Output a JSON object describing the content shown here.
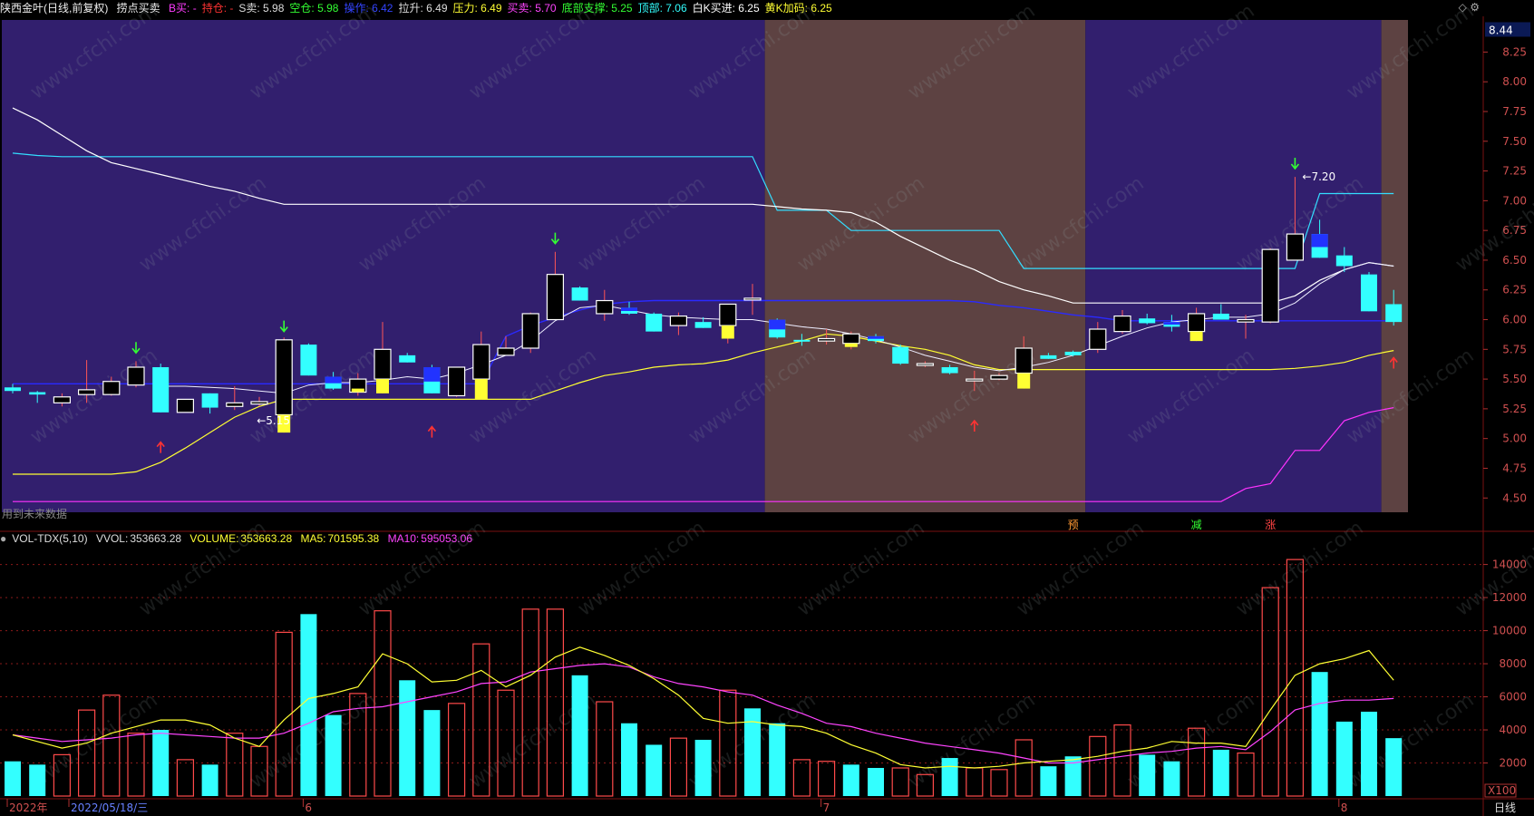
{
  "header": {
    "stock_title": "陕西金叶(日线,前复权)",
    "indicator_name": "捞点买卖",
    "items": [
      {
        "label": "B买:",
        "value": "-",
        "color": "#ff3cff"
      },
      {
        "label": "持仓:",
        "value": "-",
        "color": "#ff3333"
      },
      {
        "label": "S卖:",
        "value": "5.98",
        "color": "#dddddd"
      },
      {
        "label": "空仓:",
        "value": "5.98",
        "color": "#33ff33"
      },
      {
        "label": "操作:",
        "value": "6.42",
        "color": "#3344ff"
      },
      {
        "label": "拉升:",
        "value": "6.49",
        "color": "#dddddd"
      },
      {
        "label": "压力:",
        "value": "6.49",
        "color": "#ffff33"
      },
      {
        "label": "买卖:",
        "value": "5.70",
        "color": "#ff44ff"
      },
      {
        "label": "底部支撑:",
        "value": "5.25",
        "color": "#33ff33"
      },
      {
        "label": "顶部:",
        "value": "7.06",
        "color": "#33ffff"
      },
      {
        "label": "白K买进:",
        "value": "6.25",
        "color": "#ffffff"
      },
      {
        "label": "黄K加码:",
        "value": "6.25",
        "color": "#ffff33"
      }
    ],
    "icons": [
      "diamond-icon",
      "gear-icon"
    ]
  },
  "volume_header": {
    "indicator": "VOL-TDX(5,10)",
    "vvol_label": "VVOL:",
    "vvol_value": "353663.28",
    "volume_label": "VOLUME:",
    "volume_value": "353663.28",
    "ma5_label": "MA5:",
    "ma5_value": "701595.38",
    "ma10_label": "MA10:",
    "ma10_value": "595053.06"
  },
  "price_axis": {
    "ticks": [
      "8.25",
      "8.00",
      "7.75",
      "7.50",
      "7.25",
      "7.00",
      "6.75",
      "6.50",
      "6.25",
      "6.00",
      "5.75",
      "5.50",
      "5.25",
      "5.00",
      "4.75",
      "4.50"
    ],
    "current_price": "8.44",
    "ylim": [
      4.38,
      8.52
    ]
  },
  "volume_axis": {
    "ticks": [
      "14000",
      "12000",
      "10000",
      "8000",
      "6000",
      "4000",
      "2000"
    ],
    "unit": "X100",
    "ylim": [
      0,
      14800
    ]
  },
  "time_axis": {
    "labels": [
      {
        "text": "2022年",
        "index": 0
      },
      {
        "text": "2022/05/18/三",
        "index": 2.5
      },
      {
        "text": "6",
        "index": 12
      },
      {
        "text": "7",
        "index": 33
      },
      {
        "text": "8",
        "index": 54
      }
    ],
    "period": "日线"
  },
  "annotations": {
    "left_note": "用到未来数据",
    "low_label": "←5.15",
    "high_label": "←7.20",
    "tags": [
      {
        "text": "预",
        "index": 43,
        "color": "#ff9933"
      },
      {
        "text": "减",
        "index": 48,
        "color": "#33ff33"
      },
      {
        "text": "涨",
        "index": 51,
        "color": "#ff4444"
      }
    ]
  },
  "colors": {
    "background_purple": "#321f6e",
    "background_brown": "#5d4242",
    "up_candle": "#ffffff",
    "down_candle": "#33ffff",
    "blue_candle": "#2233ff",
    "yellow_candle": "#ffff33",
    "volume_up": "#ff4a4a",
    "volume_down": "#33ffff",
    "ma5": "#ffff33",
    "ma10": "#ff44ff",
    "grid": "#8a1a1a"
  },
  "chart_data": {
    "type": "candlestick",
    "bg_zones": [
      {
        "from": 0,
        "to": 30,
        "color": "purple"
      },
      {
        "from": 31,
        "to": 43,
        "color": "brown"
      },
      {
        "from": 44,
        "to": 55,
        "color": "purple"
      },
      {
        "from": 56,
        "to": 57,
        "color": "brown"
      }
    ],
    "candles": [
      {
        "o": 5.43,
        "h": 5.46,
        "l": 5.38,
        "c": 5.4,
        "t": "down"
      },
      {
        "o": 5.39,
        "h": 5.4,
        "l": 5.3,
        "c": 5.37,
        "t": "down"
      },
      {
        "o": 5.3,
        "h": 5.38,
        "l": 5.27,
        "c": 5.35,
        "t": "up"
      },
      {
        "o": 5.37,
        "h": 5.66,
        "l": 5.3,
        "c": 5.41,
        "t": "up"
      },
      {
        "o": 5.37,
        "h": 5.52,
        "l": 5.36,
        "c": 5.48,
        "t": "up"
      },
      {
        "o": 5.45,
        "h": 5.65,
        "l": 5.43,
        "c": 5.6,
        "t": "up"
      },
      {
        "o": 5.6,
        "h": 5.63,
        "l": 5.22,
        "c": 5.22,
        "t": "down"
      },
      {
        "o": 5.22,
        "h": 5.33,
        "l": 5.22,
        "c": 5.33,
        "t": "up"
      },
      {
        "o": 5.38,
        "h": 5.38,
        "l": 5.21,
        "c": 5.26,
        "t": "down"
      },
      {
        "o": 5.27,
        "h": 5.44,
        "l": 5.24,
        "c": 5.3,
        "t": "up"
      },
      {
        "o": 5.29,
        "h": 5.35,
        "l": 5.27,
        "c": 5.31,
        "t": "up"
      },
      {
        "o": 5.2,
        "h": 5.85,
        "l": 5.05,
        "c": 5.83,
        "t": "up",
        "ext": "yellow",
        "ext_low": 5.05,
        "ext_high": 5.2
      },
      {
        "o": 5.79,
        "h": 5.8,
        "l": 5.53,
        "c": 5.53,
        "t": "down"
      },
      {
        "o": 5.52,
        "h": 5.56,
        "l": 5.41,
        "c": 5.42,
        "t": "down",
        "mix": "blue"
      },
      {
        "o": 5.39,
        "h": 5.55,
        "l": 5.36,
        "c": 5.5,
        "t": "up",
        "ext": "yellow",
        "ext_low": 5.39,
        "ext_high": 5.42
      },
      {
        "o": 5.5,
        "h": 5.98,
        "l": 5.38,
        "c": 5.75,
        "t": "up",
        "ext": "yellow",
        "ext_low": 5.38,
        "ext_high": 5.5
      },
      {
        "o": 5.7,
        "h": 5.72,
        "l": 5.64,
        "c": 5.64,
        "t": "down"
      },
      {
        "o": 5.6,
        "h": 5.62,
        "l": 5.38,
        "c": 5.38,
        "t": "down",
        "mix": "blue"
      },
      {
        "o": 5.36,
        "h": 5.6,
        "l": 5.35,
        "c": 5.6,
        "t": "up"
      },
      {
        "o": 5.5,
        "h": 5.9,
        "l": 5.33,
        "c": 5.79,
        "t": "up",
        "ext": "yellow",
        "ext_low": 5.33,
        "ext_high": 5.5
      },
      {
        "o": 5.7,
        "h": 5.86,
        "l": 5.7,
        "c": 5.76,
        "t": "up"
      },
      {
        "o": 5.76,
        "h": 6.06,
        "l": 5.72,
        "c": 6.05,
        "t": "up"
      },
      {
        "o": 6.0,
        "h": 6.57,
        "l": 6.0,
        "c": 6.38,
        "t": "up"
      },
      {
        "o": 6.27,
        "h": 6.28,
        "l": 6.16,
        "c": 6.16,
        "t": "down"
      },
      {
        "o": 6.16,
        "h": 6.25,
        "l": 5.99,
        "c": 6.05,
        "t": "up"
      },
      {
        "o": 6.1,
        "h": 6.15,
        "l": 6.04,
        "c": 6.05,
        "t": "down",
        "mix": "blue"
      },
      {
        "o": 6.05,
        "h": 6.06,
        "l": 5.9,
        "c": 5.9,
        "t": "down"
      },
      {
        "o": 5.95,
        "h": 6.06,
        "l": 5.87,
        "c": 6.03,
        "t": "up"
      },
      {
        "o": 5.98,
        "h": 6.02,
        "l": 5.93,
        "c": 5.93,
        "t": "down"
      },
      {
        "o": 5.95,
        "h": 6.13,
        "l": 5.8,
        "c": 6.13,
        "t": "up",
        "ext": "yellow",
        "ext_low": 5.84,
        "ext_high": 5.95
      },
      {
        "o": 6.18,
        "h": 6.3,
        "l": 6.04,
        "c": 6.18,
        "t": "up"
      },
      {
        "o": 6.0,
        "h": 6.01,
        "l": 5.84,
        "c": 5.85,
        "t": "down",
        "mix": "blue"
      },
      {
        "o": 5.83,
        "h": 5.88,
        "l": 5.78,
        "c": 5.82,
        "t": "down"
      },
      {
        "o": 5.82,
        "h": 5.92,
        "l": 5.79,
        "c": 5.84,
        "t": "up"
      },
      {
        "o": 5.8,
        "h": 5.9,
        "l": 5.75,
        "c": 5.88,
        "t": "up",
        "ext": "yellow",
        "ext_low": 5.77,
        "ext_high": 5.8
      },
      {
        "o": 5.86,
        "h": 5.88,
        "l": 5.8,
        "c": 5.82,
        "t": "down",
        "mix": "blue"
      },
      {
        "o": 5.77,
        "h": 5.79,
        "l": 5.62,
        "c": 5.63,
        "t": "down"
      },
      {
        "o": 5.63,
        "h": 5.65,
        "l": 5.6,
        "c": 5.63,
        "t": "up"
      },
      {
        "o": 5.6,
        "h": 5.62,
        "l": 5.54,
        "c": 5.55,
        "t": "down"
      },
      {
        "o": 5.5,
        "h": 5.57,
        "l": 5.4,
        "c": 5.5,
        "t": "up"
      },
      {
        "o": 5.5,
        "h": 5.55,
        "l": 5.49,
        "c": 5.53,
        "t": "up"
      },
      {
        "o": 5.55,
        "h": 5.86,
        "l": 5.42,
        "c": 5.76,
        "t": "up",
        "ext": "yellow",
        "ext_low": 5.42,
        "ext_high": 5.55
      },
      {
        "o": 5.7,
        "h": 5.72,
        "l": 5.67,
        "c": 5.67,
        "t": "down"
      },
      {
        "o": 5.7,
        "h": 5.74,
        "l": 5.69,
        "c": 5.73,
        "t": "down"
      },
      {
        "o": 5.75,
        "h": 5.98,
        "l": 5.72,
        "c": 5.92,
        "t": "up"
      },
      {
        "o": 5.9,
        "h": 6.08,
        "l": 5.88,
        "c": 6.03,
        "t": "up"
      },
      {
        "o": 6.01,
        "h": 6.05,
        "l": 5.96,
        "c": 5.97,
        "t": "down"
      },
      {
        "o": 5.98,
        "h": 6.04,
        "l": 5.9,
        "c": 5.94,
        "t": "down",
        "mix": "blue"
      },
      {
        "o": 5.9,
        "h": 6.1,
        "l": 5.82,
        "c": 6.05,
        "t": "up",
        "ext": "yellow",
        "ext_low": 5.82,
        "ext_high": 5.9
      },
      {
        "o": 6.05,
        "h": 6.13,
        "l": 6.02,
        "c": 6.0,
        "t": "down"
      },
      {
        "o": 5.98,
        "h": 6.04,
        "l": 5.84,
        "c": 6.0,
        "t": "up"
      },
      {
        "o": 5.98,
        "h": 6.6,
        "l": 5.97,
        "c": 6.59,
        "t": "up"
      },
      {
        "o": 6.72,
        "h": 7.2,
        "l": 6.5,
        "c": 6.5,
        "t": "up"
      },
      {
        "o": 6.72,
        "h": 6.84,
        "l": 6.52,
        "c": 6.52,
        "t": "down",
        "mix": "blue"
      },
      {
        "o": 6.54,
        "h": 6.61,
        "l": 6.4,
        "c": 6.45,
        "t": "down"
      },
      {
        "o": 6.38,
        "h": 6.4,
        "l": 6.07,
        "c": 6.07,
        "t": "down"
      },
      {
        "o": 6.13,
        "h": 6.25,
        "l": 5.95,
        "c": 5.98,
        "t": "down"
      }
    ],
    "lines": {
      "white_ma": [
        7.78,
        7.68,
        7.55,
        7.42,
        7.32,
        7.27,
        7.22,
        7.17,
        7.12,
        7.08,
        7.02,
        6.97,
        6.97,
        6.97,
        6.97,
        6.97,
        6.97,
        6.97,
        6.97,
        6.97,
        6.97,
        6.97,
        6.97,
        6.97,
        6.97,
        6.97,
        6.97,
        6.97,
        6.97,
        6.97,
        6.97,
        6.95,
        6.93,
        6.92,
        6.9,
        6.82,
        6.7,
        6.6,
        6.5,
        6.42,
        6.32,
        6.25,
        6.2,
        6.14,
        6.14,
        6.14,
        6.14,
        6.14,
        6.14,
        6.14,
        6.14,
        6.14,
        6.2,
        6.33,
        6.42,
        6.48,
        6.45
      ],
      "cyan_line": [
        7.4,
        7.38,
        7.37,
        7.37,
        7.37,
        7.37,
        7.37,
        7.37,
        7.37,
        7.37,
        7.37,
        7.37,
        7.37,
        7.37,
        7.37,
        7.37,
        7.37,
        7.37,
        7.37,
        7.37,
        7.37,
        7.37,
        7.37,
        7.37,
        7.37,
        7.37,
        7.37,
        7.37,
        7.37,
        7.37,
        7.37,
        6.92,
        6.92,
        6.92,
        6.75,
        6.75,
        6.75,
        6.75,
        6.75,
        6.75,
        6.75,
        6.43,
        6.43,
        6.43,
        6.43,
        6.43,
        6.43,
        6.43,
        6.43,
        6.43,
        6.43,
        6.43,
        6.43,
        7.06,
        7.06,
        7.06,
        7.06
      ],
      "blue_line": [
        5.46,
        5.46,
        5.46,
        5.46,
        5.46,
        5.46,
        5.46,
        5.46,
        5.46,
        5.46,
        5.46,
        5.46,
        5.46,
        5.46,
        5.46,
        5.46,
        5.46,
        5.46,
        5.46,
        5.46,
        5.86,
        5.95,
        6.02,
        6.08,
        6.13,
        6.15,
        6.16,
        6.16,
        6.16,
        6.16,
        6.16,
        6.16,
        6.16,
        6.16,
        6.16,
        6.16,
        6.16,
        6.16,
        6.16,
        6.15,
        6.12,
        6.1,
        6.07,
        6.04,
        6.02,
        5.99,
        5.99,
        5.99,
        5.99,
        5.99,
        5.99,
        5.99,
        5.99,
        5.99,
        5.99,
        5.99,
        5.99
      ],
      "thin_white": [
        null,
        null,
        null,
        null,
        null,
        null,
        5.44,
        5.44,
        5.43,
        5.42,
        5.4,
        5.38,
        5.45,
        5.47,
        5.47,
        5.49,
        5.52,
        5.5,
        5.55,
        5.62,
        5.7,
        5.82,
        5.99,
        6.1,
        6.12,
        6.08,
        6.04,
        6.02,
        6.01,
        6.0,
        6.0,
        5.97,
        5.94,
        5.92,
        5.88,
        5.83,
        5.77,
        5.7,
        5.65,
        5.6,
        5.57,
        5.6,
        5.64,
        5.7,
        5.78,
        5.86,
        5.93,
        5.98,
        6.0,
        6.02,
        6.02,
        6.05,
        6.14,
        6.3,
        6.42,
        6.48,
        6.45
      ],
      "yellow_line": [
        4.7,
        4.7,
        4.7,
        4.7,
        4.7,
        4.72,
        4.8,
        4.92,
        5.05,
        5.18,
        5.27,
        5.33,
        5.33,
        5.33,
        5.33,
        5.33,
        5.33,
        5.33,
        5.33,
        5.33,
        5.33,
        5.33,
        5.4,
        5.47,
        5.53,
        5.56,
        5.6,
        5.62,
        5.63,
        5.66,
        5.72,
        5.77,
        5.82,
        5.88,
        5.86,
        5.82,
        5.78,
        5.75,
        5.7,
        5.62,
        5.58,
        5.58,
        5.58,
        5.58,
        5.58,
        5.58,
        5.58,
        5.58,
        5.58,
        5.58,
        5.58,
        5.58,
        5.59,
        5.61,
        5.64,
        5.7,
        5.74
      ],
      "magenta_line": [
        4.47,
        4.47,
        4.47,
        4.47,
        4.47,
        4.47,
        4.47,
        4.47,
        4.47,
        4.47,
        4.47,
        4.47,
        4.47,
        4.47,
        4.47,
        4.47,
        4.47,
        4.47,
        4.47,
        4.47,
        4.47,
        4.47,
        4.47,
        4.47,
        4.47,
        4.47,
        4.47,
        4.47,
        4.47,
        4.47,
        4.47,
        4.47,
        4.47,
        4.47,
        4.47,
        4.47,
        4.47,
        4.47,
        4.47,
        4.47,
        4.47,
        4.47,
        4.47,
        4.47,
        4.47,
        4.47,
        4.47,
        4.47,
        4.47,
        4.47,
        4.58,
        4.62,
        4.9,
        4.9,
        5.15,
        5.22,
        5.26
      ]
    },
    "arrows": [
      {
        "index": 5,
        "price": 5.72,
        "dir": "down",
        "color": "#33ff33"
      },
      {
        "index": 11,
        "price": 5.9,
        "dir": "down",
        "color": "#33ff33"
      },
      {
        "index": 22,
        "price": 6.64,
        "dir": "down",
        "color": "#33ff33"
      },
      {
        "index": 52,
        "price": 7.27,
        "dir": "down",
        "color": "#33ff33"
      },
      {
        "index": 6,
        "price": 4.97,
        "dir": "up",
        "color": "#ff3333"
      },
      {
        "index": 17,
        "price": 5.1,
        "dir": "up",
        "color": "#ff3333"
      },
      {
        "index": 39,
        "price": 5.15,
        "dir": "up",
        "color": "#ff3333"
      },
      {
        "index": 56,
        "price": 5.68,
        "dir": "up",
        "color": "#ff3333"
      }
    ],
    "volume": {
      "values": [
        2100,
        1900,
        2500,
        5200,
        6100,
        3800,
        4000,
        2200,
        1900,
        3800,
        3000,
        9900,
        11000,
        4900,
        6200,
        11200,
        7000,
        5200,
        5600,
        9200,
        6400,
        11300,
        11300,
        7300,
        5700,
        4400,
        3100,
        3500,
        3400,
        6400,
        5300,
        4400,
        2200,
        2100,
        1900,
        1700,
        1700,
        1300,
        2300,
        1700,
        1600,
        3400,
        1800,
        2400,
        3600,
        4300,
        2500,
        2100,
        4100,
        2800,
        2600,
        12600,
        14300,
        7500,
        4500,
        5100,
        3500
      ],
      "colors": [
        "down",
        "down",
        "up",
        "up",
        "up",
        "up",
        "down",
        "up",
        "down",
        "up",
        "up",
        "up",
        "down",
        "down",
        "up",
        "up",
        "down",
        "down",
        "up",
        "up",
        "up",
        "up",
        "up",
        "down",
        "up",
        "down",
        "down",
        "up",
        "down",
        "up",
        "down",
        "down",
        "up",
        "up",
        "down",
        "down",
        "up",
        "up",
        "down",
        "up",
        "up",
        "up",
        "down",
        "down",
        "up",
        "up",
        "down",
        "down",
        "up",
        "down",
        "up",
        "up",
        "up",
        "down",
        "down",
        "down",
        "down"
      ],
      "ma5": [
        3700,
        3300,
        2900,
        3200,
        3800,
        4200,
        4600,
        4600,
        4300,
        3500,
        3000,
        4600,
        5900,
        6200,
        6600,
        8600,
        8000,
        6900,
        7000,
        7600,
        6600,
        7300,
        8400,
        9000,
        8500,
        7900,
        7100,
        6100,
        4700,
        4400,
        4500,
        4300,
        4200,
        3800,
        3100,
        2600,
        1900,
        1700,
        1800,
        1700,
        1800,
        2000,
        2100,
        2200,
        2400,
        2700,
        2900,
        3300,
        3200,
        3200,
        3000,
        5200,
        7300,
        8000,
        8300,
        8800,
        7000
      ],
      "ma10": [
        3700,
        3500,
        3300,
        3400,
        3500,
        3700,
        3800,
        3700,
        3600,
        3500,
        3500,
        3800,
        4400,
        5100,
        5300,
        5400,
        5700,
        6000,
        6300,
        6800,
        6900,
        7500,
        7700,
        7900,
        8000,
        7800,
        7200,
        6800,
        6600,
        6300,
        6100,
        5500,
        5000,
        4400,
        4200,
        3800,
        3500,
        3200,
        3000,
        2800,
        2600,
        2300,
        2000,
        2000,
        2200,
        2400,
        2600,
        2700,
        2900,
        3000,
        2800,
        3900,
        5200,
        5600,
        5800,
        5800,
        5900
      ]
    }
  }
}
